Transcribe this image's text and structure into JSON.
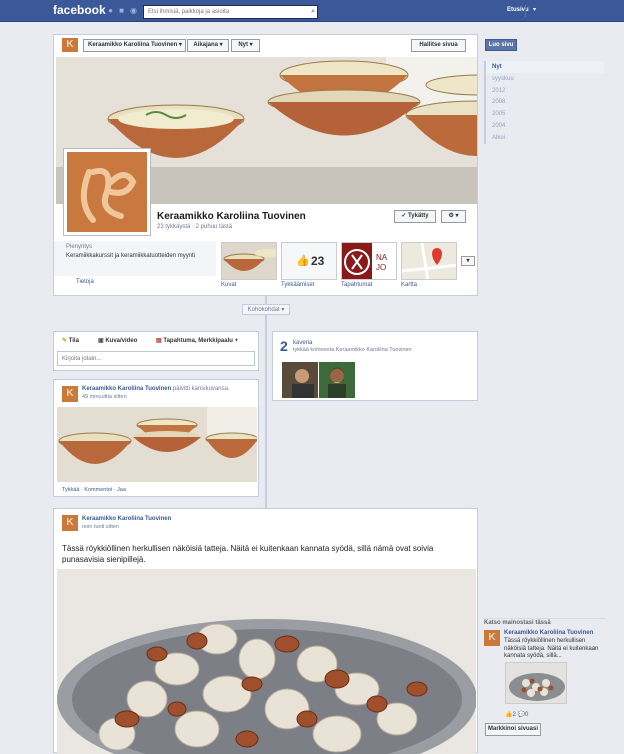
{
  "topbar": {
    "logo": "facebook",
    "search_placeholder": "Etsi ihmisiä, paikkoja ja asioita",
    "home": "Etusivu",
    "caret": "▾"
  },
  "header": {
    "page_name_button": "Keraamikko Karoliina Tuovinen",
    "timeline_button": "Aikajana",
    "now_button": "Nyt",
    "manage_button": "Hallitse sivua",
    "dropdown": "▾"
  },
  "cover": {
    "title": "Keraamikko Karoliina Tuovinen",
    "likes_text": "23 tykkäystä · 2 puhuu tästä",
    "like_button": "✓ Tykätty",
    "gear_button": "⚙ ▾"
  },
  "about": {
    "category": "Pienyritys",
    "description": "Keramiikkakurssit ja keramiikkatuotteiden myynti",
    "info_link": "Tietoja"
  },
  "thumbs": {
    "photos": "Kuvat",
    "likes": "Tykkäämiset",
    "likes_count": "23",
    "events": "Tapahtumat",
    "map": "Kartta",
    "more": "▾"
  },
  "timeline": {
    "highlights": "Kohokohdat ▾"
  },
  "composer": {
    "tab_status": "Tila",
    "tab_photo": "Kuva/video",
    "tab_event": "Tapahtuma, Merkkipaalu +",
    "placeholder": "Kirjoita jotain..."
  },
  "friends": {
    "count": "2",
    "label": "kaveria",
    "subtitle": "tykkää kohteesta Keraamikko Karoliina Tuovinen"
  },
  "post1": {
    "author": "Keraamikko Karoliina Tuovinen",
    "action": " päivitti kansikuvansa.",
    "time": "49 minuuttia sitten",
    "actions": "Tykkää · Kommentoi · Jaa"
  },
  "post2": {
    "author": "Keraamikko Karoliina Tuovinen",
    "time": "noin tunti sitten",
    "text": "Tässä röykkiöllinen herkullisen näköisiä tatteja. Näitä ei kuitenkaan kannata syödä, sillä nämä ovat soivia punasavisia sienipillejä."
  },
  "years": {
    "items": [
      "Nyt",
      "syyskuu",
      "2012",
      "2008",
      "2005",
      "2004",
      "Alkoi"
    ],
    "create_page": "Luo sivu"
  },
  "ad": {
    "heading": "Katso mainostasi tässä",
    "title": "Keraamikko Karoliina Tuovinen",
    "text": "Tässä röykkiöllinen herkullisen näköisiä tatteja. Näitä ei kuitenkaan kannata syödä, sillä...",
    "stats": "👍2 💬0",
    "button": "Markkinoi sivuasi"
  },
  "colors": {
    "brand": "#3b5998",
    "background": "#e9ebf1"
  }
}
